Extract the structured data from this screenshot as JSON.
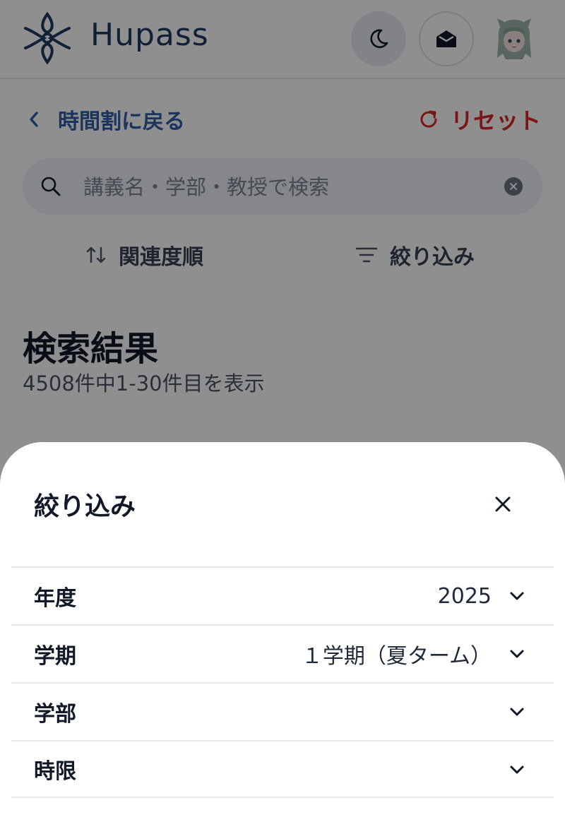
{
  "header": {
    "logo_text": "Hupass",
    "theme_icon": "moon-icon",
    "mail_icon": "mail-icon"
  },
  "nav": {
    "back_label": "時間割に戻る",
    "reset_label": "リセット"
  },
  "search": {
    "placeholder": "講義名・学部・教授で検索",
    "value": ""
  },
  "controls": {
    "sort_label": "関連度順",
    "filter_label": "絞り込み"
  },
  "results": {
    "title": "検索結果",
    "count_text": "4508件中1-30件目を表示"
  },
  "sheet": {
    "title": "絞り込み",
    "filters": [
      {
        "label": "年度",
        "value": "2025"
      },
      {
        "label": "学期",
        "value": "１学期（夏ターム）"
      },
      {
        "label": "学部",
        "value": ""
      },
      {
        "label": "時限",
        "value": ""
      }
    ]
  },
  "colors": {
    "brand": "#1e3a5f",
    "link": "#2f5ea8",
    "reset": "#dc2626",
    "overlay": "rgba(0,0,0,0.44)"
  }
}
